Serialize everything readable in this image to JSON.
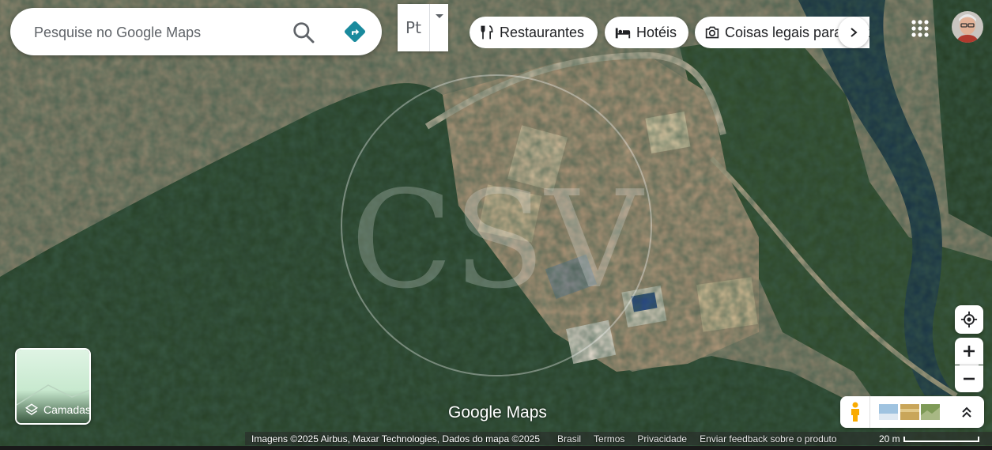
{
  "search": {
    "placeholder": "Pesquise no Google Maps",
    "search_icon": "search-icon",
    "directions_icon": "directions-icon"
  },
  "input_tools": {
    "label": "Pt"
  },
  "chips": [
    {
      "label": "Restaurantes",
      "icon": "fork-knife-icon"
    },
    {
      "label": "Hotéis",
      "icon": "bed-icon"
    },
    {
      "label": "Coisas legais para fazer",
      "icon": "camera-icon"
    }
  ],
  "layers": {
    "label": "Camadas"
  },
  "branding": {
    "google": "Google",
    "maps": "Maps"
  },
  "footer": {
    "attribution": "Imagens ©2025 Airbus, Maxar Technologies, Dados do mapa ©2025",
    "country": "Brasil",
    "terms": "Termos",
    "privacy": "Privacidade",
    "feedback": "Enviar feedback sobre o produto",
    "scale": "20 m"
  },
  "watermark": {
    "text": "CSV"
  },
  "colors": {
    "accent_teal": "#1a8a9d",
    "control_icon": "#5f6368",
    "pegman": "#f9ab00"
  }
}
